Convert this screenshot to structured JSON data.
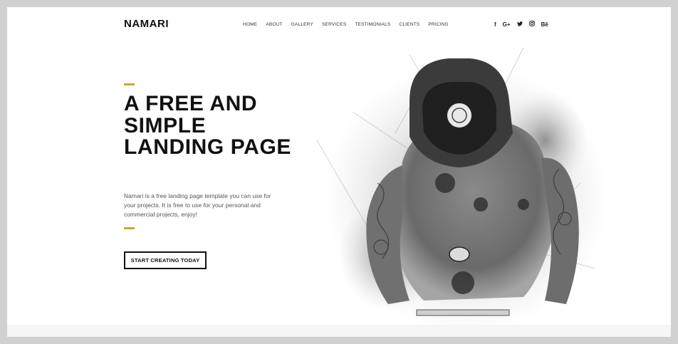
{
  "brand": {
    "logo_text": "NAMARI"
  },
  "nav": {
    "items": [
      "HOME",
      "ABOUT",
      "GALLERY",
      "SERVICES",
      "TESTIMONIALS",
      "CLIENTS",
      "PRICING"
    ]
  },
  "social": {
    "icons": [
      {
        "name": "facebook-icon",
        "glyph": "f"
      },
      {
        "name": "google-plus-icon",
        "glyph": "G+"
      },
      {
        "name": "twitter-icon",
        "glyph": "🐦"
      },
      {
        "name": "instagram-icon",
        "glyph": "◎"
      },
      {
        "name": "behance-icon",
        "glyph": "Bē"
      }
    ]
  },
  "hero": {
    "title": "A FREE AND SIMPLE LANDING PAGE",
    "description": "Namari is a free landing page template you can use for your projects. It is free to use for your personal and commercial projects, enjoy!",
    "cta_label": "START CREATING TODAY"
  },
  "colors": {
    "accent": "#c9a640",
    "text_dark": "#111111",
    "backdrop": "#d1d1d1"
  }
}
